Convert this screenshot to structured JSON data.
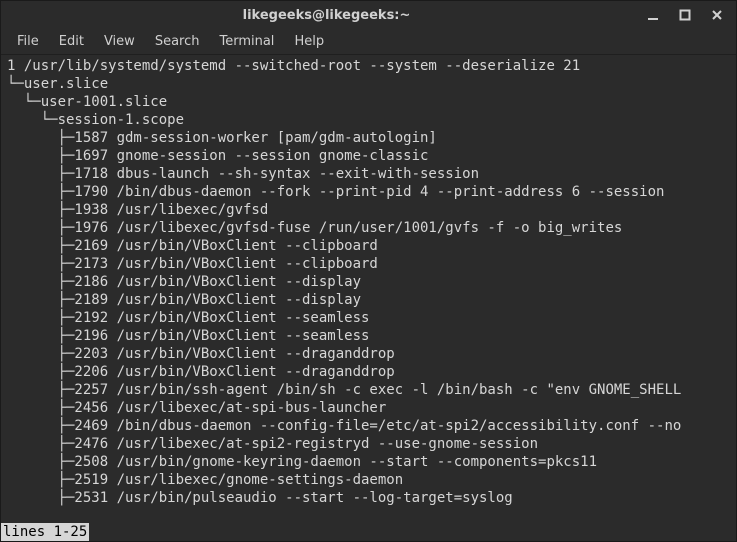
{
  "title": "likegeeks@likegeeks:~",
  "menu": {
    "file": "File",
    "edit": "Edit",
    "view": "View",
    "search": "Search",
    "terminal": "Terminal",
    "help": "Help"
  },
  "tree": {
    "root": {
      "pid": "1",
      "cmd": "/usr/lib/systemd/systemd --switched-root --system --deserialize 21"
    },
    "userslice": "user.slice",
    "user1001slice": "user-1001.slice",
    "sessionscope": "session-1.scope",
    "procs": [
      {
        "pid": "1587",
        "cmd": "gdm-session-worker [pam/gdm-autologin]"
      },
      {
        "pid": "1697",
        "cmd": "gnome-session --session gnome-classic"
      },
      {
        "pid": "1718",
        "cmd": "dbus-launch --sh-syntax --exit-with-session"
      },
      {
        "pid": "1790",
        "cmd": "/bin/dbus-daemon --fork --print-pid 4 --print-address 6 --session"
      },
      {
        "pid": "1938",
        "cmd": "/usr/libexec/gvfsd"
      },
      {
        "pid": "1976",
        "cmd": "/usr/libexec/gvfsd-fuse /run/user/1001/gvfs -f -o big_writes"
      },
      {
        "pid": "2169",
        "cmd": "/usr/bin/VBoxClient --clipboard"
      },
      {
        "pid": "2173",
        "cmd": "/usr/bin/VBoxClient --clipboard"
      },
      {
        "pid": "2186",
        "cmd": "/usr/bin/VBoxClient --display"
      },
      {
        "pid": "2189",
        "cmd": "/usr/bin/VBoxClient --display"
      },
      {
        "pid": "2192",
        "cmd": "/usr/bin/VBoxClient --seamless"
      },
      {
        "pid": "2196",
        "cmd": "/usr/bin/VBoxClient --seamless"
      },
      {
        "pid": "2203",
        "cmd": "/usr/bin/VBoxClient --draganddrop"
      },
      {
        "pid": "2206",
        "cmd": "/usr/bin/VBoxClient --draganddrop"
      },
      {
        "pid": "2257",
        "cmd": "/usr/bin/ssh-agent /bin/sh -c exec -l /bin/bash -c \"env GNOME_SHELL"
      },
      {
        "pid": "2456",
        "cmd": "/usr/libexec/at-spi-bus-launcher"
      },
      {
        "pid": "2469",
        "cmd": "/bin/dbus-daemon --config-file=/etc/at-spi2/accessibility.conf --no"
      },
      {
        "pid": "2476",
        "cmd": "/usr/libexec/at-spi2-registryd --use-gnome-session"
      },
      {
        "pid": "2508",
        "cmd": "/usr/bin/gnome-keyring-daemon --start --components=pkcs11"
      },
      {
        "pid": "2519",
        "cmd": "/usr/libexec/gnome-settings-daemon"
      },
      {
        "pid": "2531",
        "cmd": "/usr/bin/pulseaudio --start --log-target=syslog"
      }
    ]
  },
  "status": "lines 1-25"
}
